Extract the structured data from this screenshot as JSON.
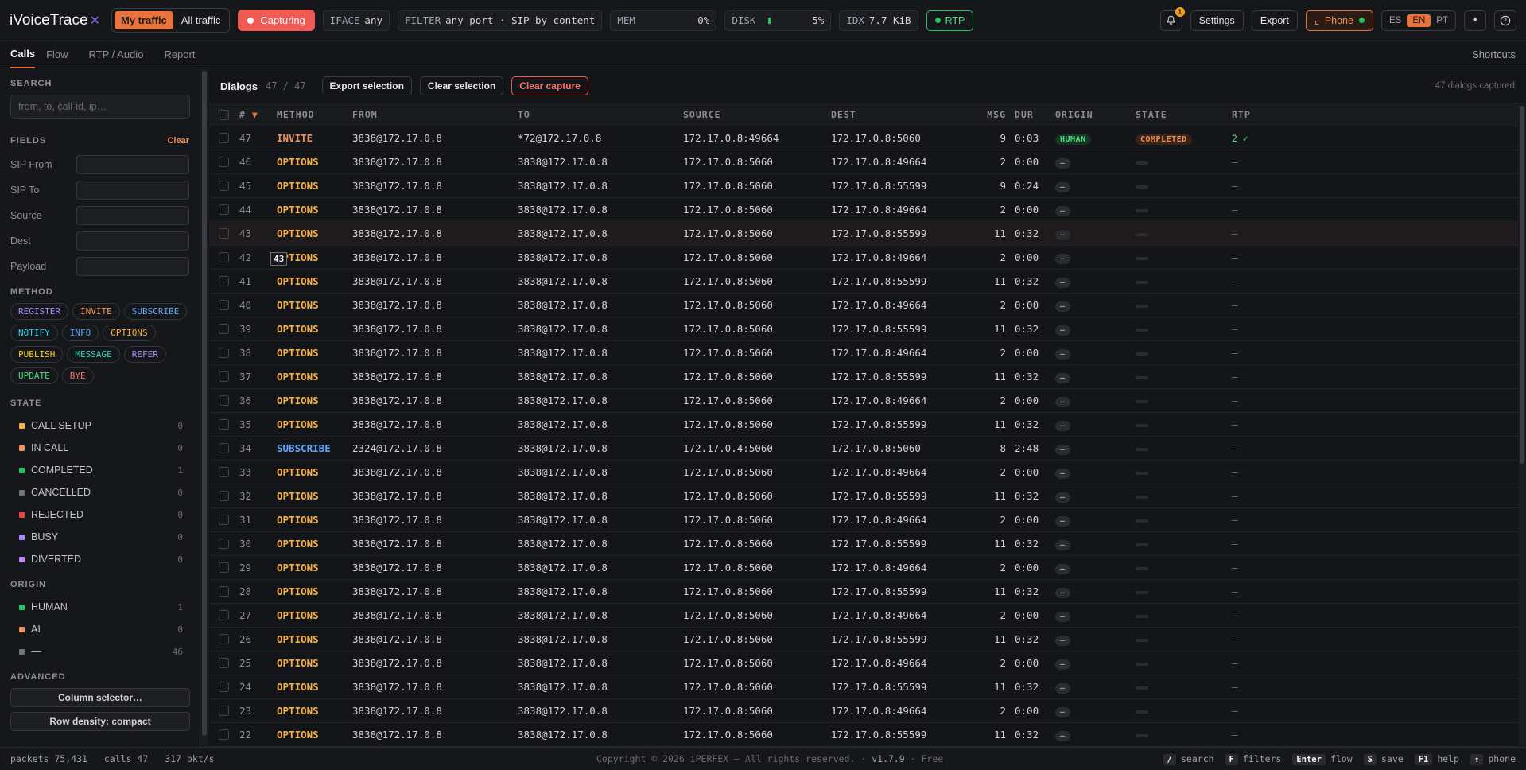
{
  "app": {
    "name": "iVoiceTrace",
    "logo_mark": "✕"
  },
  "topbar": {
    "traffic_toggle": [
      "My traffic",
      "All traffic"
    ],
    "capture_label": "Capturing",
    "iface": {
      "label": "IFACE",
      "value": "any"
    },
    "filter": {
      "label": "FILTER",
      "value": "any port · SIP by content"
    },
    "mem": {
      "label": "MEM",
      "value": "0%"
    },
    "disk": {
      "label": "DISK",
      "value": "5%"
    },
    "idx": {
      "label": "IDX",
      "value": "7.7 KiB"
    },
    "rtp_label": "RTP",
    "notifications_count": "1",
    "settings_label": "Settings",
    "export_label": "Export",
    "phone_label": "Phone",
    "languages": [
      "ES",
      "EN",
      "PT"
    ],
    "theme_icon": "✷",
    "help_icon": "?"
  },
  "tabs": [
    "Calls",
    "Flow",
    "RTP / Audio",
    "Report"
  ],
  "shortcuts_label": "Shortcuts",
  "sidebar": {
    "search_title": "SEARCH",
    "search_placeholder": "from, to, call-id, ip…",
    "fields_title": "FIELDS",
    "fields_clear": "Clear",
    "fields": [
      "SIP From",
      "SIP To",
      "Source",
      "Dest",
      "Payload"
    ],
    "method_title": "METHOD",
    "methods": [
      {
        "label": "REGISTER",
        "color": "#a78bfa"
      },
      {
        "label": "INVITE",
        "color": "#f0905a"
      },
      {
        "label": "SUBSCRIBE",
        "color": "#60a5fa"
      },
      {
        "label": "NOTIFY",
        "color": "#22d3ee"
      },
      {
        "label": "INFO",
        "color": "#60a5fa"
      },
      {
        "label": "OPTIONS",
        "color": "#f5b041"
      },
      {
        "label": "PUBLISH",
        "color": "#facc15"
      },
      {
        "label": "MESSAGE",
        "color": "#2dd4bf"
      },
      {
        "label": "REFER",
        "color": "#a78bfa"
      },
      {
        "label": "UPDATE",
        "color": "#4ade80"
      },
      {
        "label": "BYE",
        "color": "#f87171"
      }
    ],
    "state_title": "STATE",
    "states": [
      {
        "label": "CALL SETUP",
        "count": "0",
        "color": "#f5b041"
      },
      {
        "label": "IN CALL",
        "count": "0",
        "color": "#f0905a"
      },
      {
        "label": "COMPLETED",
        "count": "1",
        "color": "#22c55e"
      },
      {
        "label": "CANCELLED",
        "count": "0",
        "color": "#71717a"
      },
      {
        "label": "REJECTED",
        "count": "0",
        "color": "#ef4444"
      },
      {
        "label": "BUSY",
        "count": "0",
        "color": "#a78bfa"
      },
      {
        "label": "DIVERTED",
        "count": "0",
        "color": "#c084fc"
      }
    ],
    "origin_title": "ORIGIN",
    "origins": [
      {
        "label": "HUMAN",
        "count": "1",
        "color": "#22c55e"
      },
      {
        "label": "AI",
        "count": "0",
        "color": "#f0905a"
      },
      {
        "label": "—",
        "count": "46",
        "color": "#71717a"
      }
    ],
    "advanced_title": "ADVANCED",
    "advanced_buttons": [
      "Column selector…",
      "Row density: compact"
    ]
  },
  "main": {
    "title": "Dialogs",
    "count": "47 / 47",
    "buttons": [
      "Export selection",
      "Clear selection",
      "Clear capture"
    ],
    "total": "47 dialogs captured",
    "columns": [
      "#",
      "METHOD",
      "FROM",
      "TO",
      "SOURCE",
      "DEST",
      "MSG",
      "DUR",
      "ORIGIN",
      "STATE",
      "RTP"
    ],
    "sort_indicator": "▼",
    "tooltip": "43",
    "rows": [
      {
        "n": "47",
        "method": "INVITE",
        "from": "3838@172.17.0.8",
        "to": "*72@172.17.0.8",
        "src": "172.17.0.8:49664",
        "dst": "172.17.0.8:5060",
        "msg": "9",
        "dur": "0:03",
        "origin": "HUMAN",
        "state": "COMPLETED",
        "rtp": "2 ✓"
      },
      {
        "n": "46",
        "method": "OPTIONS",
        "from": "3838@172.17.0.8",
        "to": "3838@172.17.0.8",
        "src": "172.17.0.8:5060",
        "dst": "172.17.0.8:49664",
        "msg": "2",
        "dur": "0:00",
        "origin": "—",
        "state": "",
        "rtp": "—"
      },
      {
        "n": "45",
        "method": "OPTIONS",
        "from": "3838@172.17.0.8",
        "to": "3838@172.17.0.8",
        "src": "172.17.0.8:5060",
        "dst": "172.17.0.8:55599",
        "msg": "9",
        "dur": "0:24",
        "origin": "—",
        "state": "",
        "rtp": "—"
      },
      {
        "n": "44",
        "method": "OPTIONS",
        "from": "3838@172.17.0.8",
        "to": "3838@172.17.0.8",
        "src": "172.17.0.8:5060",
        "dst": "172.17.0.8:49664",
        "msg": "2",
        "dur": "0:00",
        "origin": "—",
        "state": "",
        "rtp": "—"
      },
      {
        "n": "43",
        "method": "OPTIONS",
        "from": "3838@172.17.0.8",
        "to": "3838@172.17.0.8",
        "src": "172.17.0.8:5060",
        "dst": "172.17.0.8:55599",
        "msg": "11",
        "dur": "0:32",
        "origin": "—",
        "state": "",
        "rtp": "—"
      },
      {
        "n": "42",
        "method": "OPTIONS",
        "from": "3838@172.17.0.8",
        "to": "3838@172.17.0.8",
        "src": "172.17.0.8:5060",
        "dst": "172.17.0.8:49664",
        "msg": "2",
        "dur": "0:00",
        "origin": "—",
        "state": "",
        "rtp": "—"
      },
      {
        "n": "41",
        "method": "OPTIONS",
        "from": "3838@172.17.0.8",
        "to": "3838@172.17.0.8",
        "src": "172.17.0.8:5060",
        "dst": "172.17.0.8:55599",
        "msg": "11",
        "dur": "0:32",
        "origin": "—",
        "state": "",
        "rtp": "—"
      },
      {
        "n": "40",
        "method": "OPTIONS",
        "from": "3838@172.17.0.8",
        "to": "3838@172.17.0.8",
        "src": "172.17.0.8:5060",
        "dst": "172.17.0.8:49664",
        "msg": "2",
        "dur": "0:00",
        "origin": "—",
        "state": "",
        "rtp": "—"
      },
      {
        "n": "39",
        "method": "OPTIONS",
        "from": "3838@172.17.0.8",
        "to": "3838@172.17.0.8",
        "src": "172.17.0.8:5060",
        "dst": "172.17.0.8:55599",
        "msg": "11",
        "dur": "0:32",
        "origin": "—",
        "state": "",
        "rtp": "—"
      },
      {
        "n": "38",
        "method": "OPTIONS",
        "from": "3838@172.17.0.8",
        "to": "3838@172.17.0.8",
        "src": "172.17.0.8:5060",
        "dst": "172.17.0.8:49664",
        "msg": "2",
        "dur": "0:00",
        "origin": "—",
        "state": "",
        "rtp": "—"
      },
      {
        "n": "37",
        "method": "OPTIONS",
        "from": "3838@172.17.0.8",
        "to": "3838@172.17.0.8",
        "src": "172.17.0.8:5060",
        "dst": "172.17.0.8:55599",
        "msg": "11",
        "dur": "0:32",
        "origin": "—",
        "state": "",
        "rtp": "—"
      },
      {
        "n": "36",
        "method": "OPTIONS",
        "from": "3838@172.17.0.8",
        "to": "3838@172.17.0.8",
        "src": "172.17.0.8:5060",
        "dst": "172.17.0.8:49664",
        "msg": "2",
        "dur": "0:00",
        "origin": "—",
        "state": "",
        "rtp": "—"
      },
      {
        "n": "35",
        "method": "OPTIONS",
        "from": "3838@172.17.0.8",
        "to": "3838@172.17.0.8",
        "src": "172.17.0.8:5060",
        "dst": "172.17.0.8:55599",
        "msg": "11",
        "dur": "0:32",
        "origin": "—",
        "state": "",
        "rtp": "—"
      },
      {
        "n": "34",
        "method": "SUBSCRIBE",
        "from": "2324@172.17.0.8",
        "to": "3838@172.17.0.8",
        "src": "172.17.0.4:5060",
        "dst": "172.17.0.8:5060",
        "msg": "8",
        "dur": "2:48",
        "origin": "—",
        "state": "",
        "rtp": "—"
      },
      {
        "n": "33",
        "method": "OPTIONS",
        "from": "3838@172.17.0.8",
        "to": "3838@172.17.0.8",
        "src": "172.17.0.8:5060",
        "dst": "172.17.0.8:49664",
        "msg": "2",
        "dur": "0:00",
        "origin": "—",
        "state": "",
        "rtp": "—"
      },
      {
        "n": "32",
        "method": "OPTIONS",
        "from": "3838@172.17.0.8",
        "to": "3838@172.17.0.8",
        "src": "172.17.0.8:5060",
        "dst": "172.17.0.8:55599",
        "msg": "11",
        "dur": "0:32",
        "origin": "—",
        "state": "",
        "rtp": "—"
      },
      {
        "n": "31",
        "method": "OPTIONS",
        "from": "3838@172.17.0.8",
        "to": "3838@172.17.0.8",
        "src": "172.17.0.8:5060",
        "dst": "172.17.0.8:49664",
        "msg": "2",
        "dur": "0:00",
        "origin": "—",
        "state": "",
        "rtp": "—"
      },
      {
        "n": "30",
        "method": "OPTIONS",
        "from": "3838@172.17.0.8",
        "to": "3838@172.17.0.8",
        "src": "172.17.0.8:5060",
        "dst": "172.17.0.8:55599",
        "msg": "11",
        "dur": "0:32",
        "origin": "—",
        "state": "",
        "rtp": "—"
      },
      {
        "n": "29",
        "method": "OPTIONS",
        "from": "3838@172.17.0.8",
        "to": "3838@172.17.0.8",
        "src": "172.17.0.8:5060",
        "dst": "172.17.0.8:49664",
        "msg": "2",
        "dur": "0:00",
        "origin": "—",
        "state": "",
        "rtp": "—"
      },
      {
        "n": "28",
        "method": "OPTIONS",
        "from": "3838@172.17.0.8",
        "to": "3838@172.17.0.8",
        "src": "172.17.0.8:5060",
        "dst": "172.17.0.8:55599",
        "msg": "11",
        "dur": "0:32",
        "origin": "—",
        "state": "",
        "rtp": "—"
      },
      {
        "n": "27",
        "method": "OPTIONS",
        "from": "3838@172.17.0.8",
        "to": "3838@172.17.0.8",
        "src": "172.17.0.8:5060",
        "dst": "172.17.0.8:49664",
        "msg": "2",
        "dur": "0:00",
        "origin": "—",
        "state": "",
        "rtp": "—"
      },
      {
        "n": "26",
        "method": "OPTIONS",
        "from": "3838@172.17.0.8",
        "to": "3838@172.17.0.8",
        "src": "172.17.0.8:5060",
        "dst": "172.17.0.8:55599",
        "msg": "11",
        "dur": "0:32",
        "origin": "—",
        "state": "",
        "rtp": "—"
      },
      {
        "n": "25",
        "method": "OPTIONS",
        "from": "3838@172.17.0.8",
        "to": "3838@172.17.0.8",
        "src": "172.17.0.8:5060",
        "dst": "172.17.0.8:49664",
        "msg": "2",
        "dur": "0:00",
        "origin": "—",
        "state": "",
        "rtp": "—"
      },
      {
        "n": "24",
        "method": "OPTIONS",
        "from": "3838@172.17.0.8",
        "to": "3838@172.17.0.8",
        "src": "172.17.0.8:5060",
        "dst": "172.17.0.8:55599",
        "msg": "11",
        "dur": "0:32",
        "origin": "—",
        "state": "",
        "rtp": "—"
      },
      {
        "n": "23",
        "method": "OPTIONS",
        "from": "3838@172.17.0.8",
        "to": "3838@172.17.0.8",
        "src": "172.17.0.8:5060",
        "dst": "172.17.0.8:49664",
        "msg": "2",
        "dur": "0:00",
        "origin": "—",
        "state": "",
        "rtp": "—"
      },
      {
        "n": "22",
        "method": "OPTIONS",
        "from": "3838@172.17.0.8",
        "to": "3838@172.17.0.8",
        "src": "172.17.0.8:5060",
        "dst": "172.17.0.8:55599",
        "msg": "11",
        "dur": "0:32",
        "origin": "—",
        "state": "",
        "rtp": "—"
      }
    ]
  },
  "footer": {
    "packets": "packets 75,431",
    "calls": "calls 47",
    "rate": "317 pkt/s",
    "copyright": "Copyright © 2026 iPERFEX — All rights reserved. · ",
    "version": "v1.7.9",
    "edition": " · Free",
    "keys": [
      {
        "key": "/",
        "label": "search"
      },
      {
        "key": "F",
        "label": "filters"
      },
      {
        "key": "Enter",
        "label": "flow"
      },
      {
        "key": "S",
        "label": "save"
      },
      {
        "key": "F1",
        "label": "help"
      },
      {
        "key": "⇡",
        "label": "phone"
      }
    ]
  },
  "colors": {
    "accent": "#e8743b",
    "capture": "#ef5a55",
    "ok": "#22c55e",
    "options": "#f5b041",
    "invite": "#f0905a",
    "subscribe": "#60a5fa"
  }
}
